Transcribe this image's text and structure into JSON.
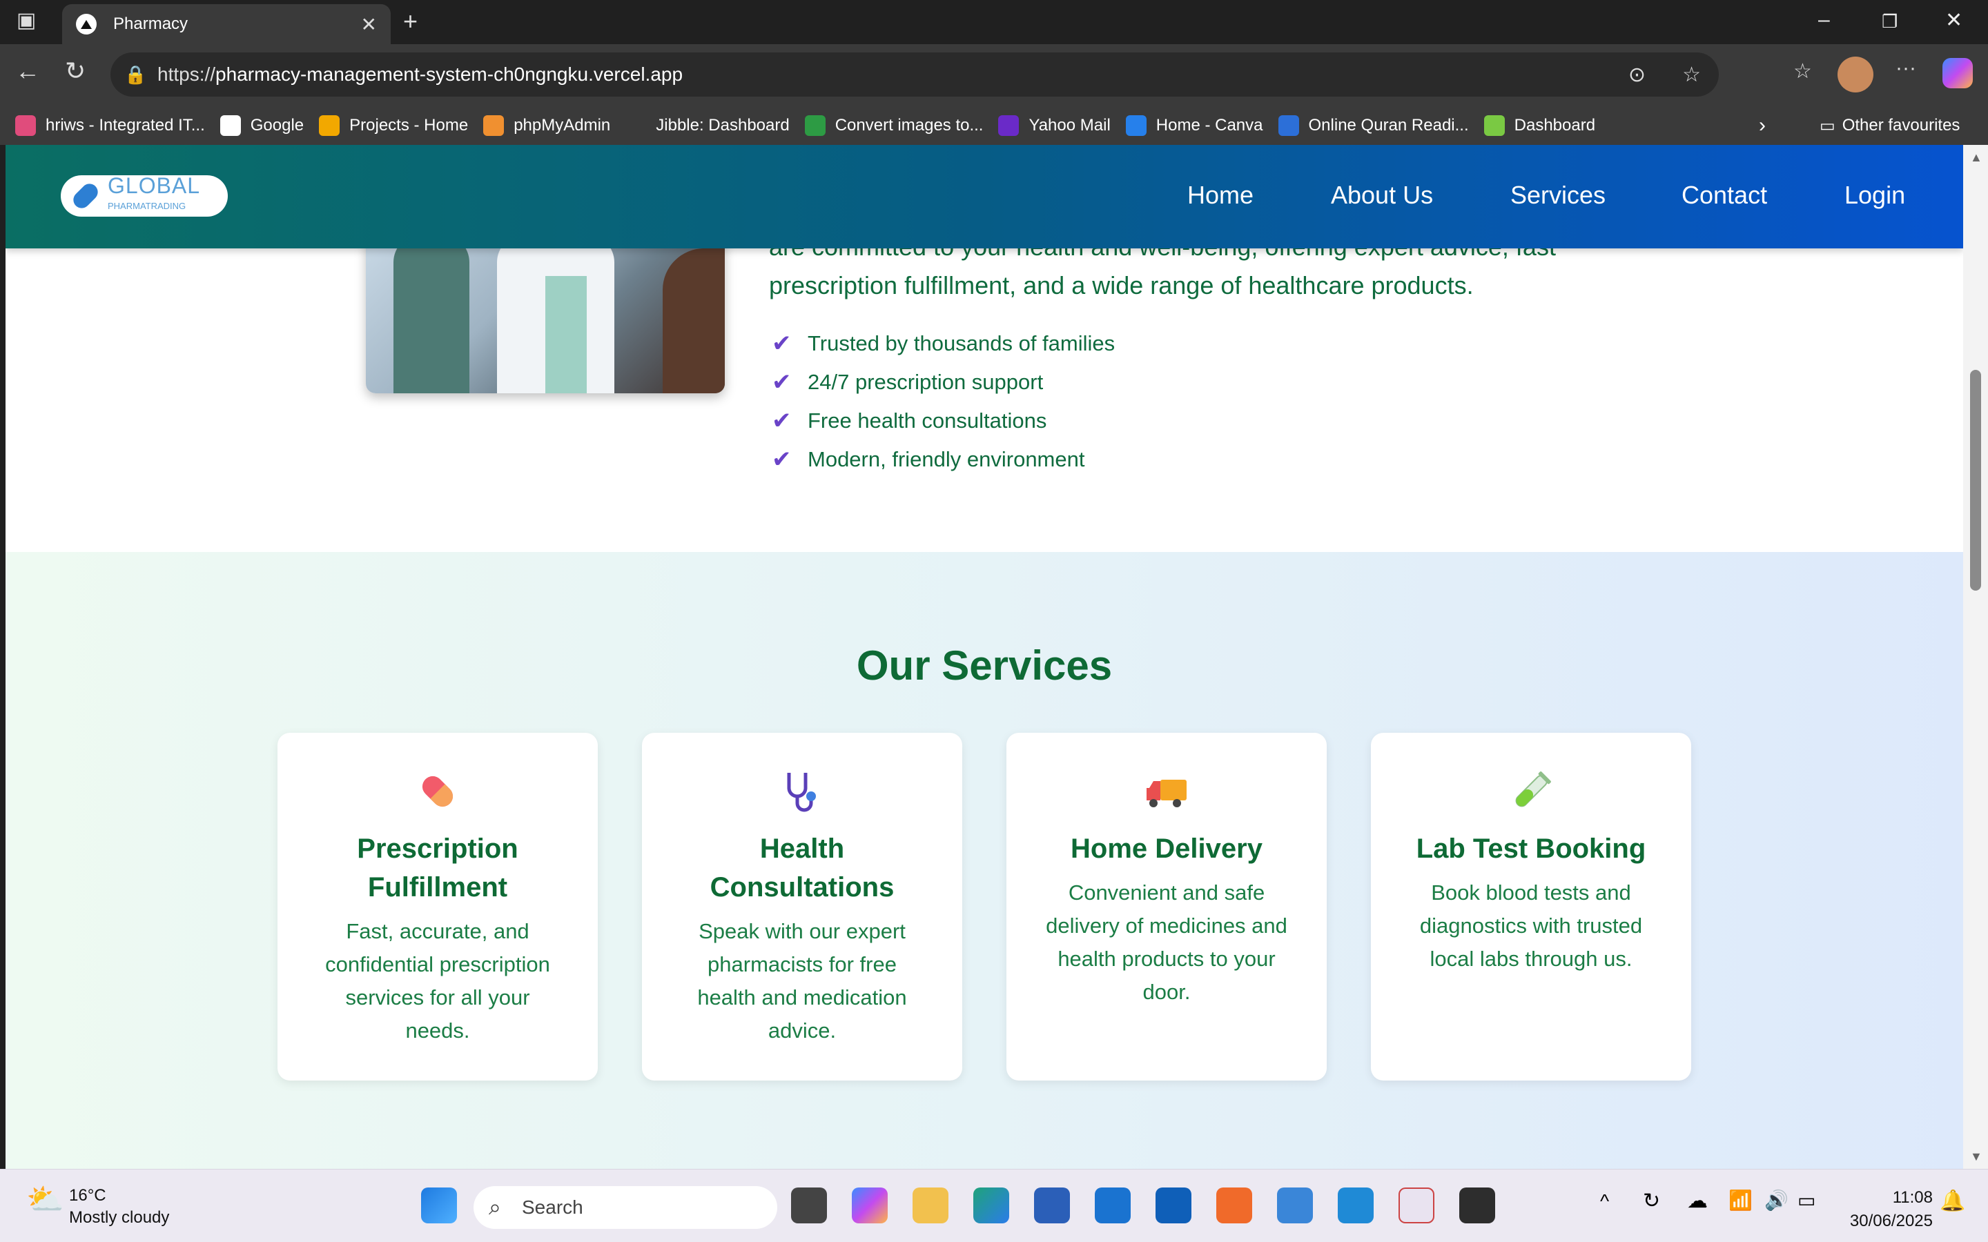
{
  "browser": {
    "tab_title": "Pharmacy",
    "url_prefix": "https://",
    "url_host": "pharmacy-management-system-ch0ngngku.vercel.app",
    "bookmarks": [
      {
        "label": "hriws - Integrated IT...",
        "color": "#e04c7c"
      },
      {
        "label": "Google",
        "color": "#ffffff"
      },
      {
        "label": "Projects - Home",
        "color": "#f2a800"
      },
      {
        "label": "phpMyAdmin",
        "color": "#f09030"
      },
      {
        "label": "Jibble: Dashboard",
        "color": "#3a3a3a"
      },
      {
        "label": "Convert images to...",
        "color": "#2d9b44"
      },
      {
        "label": "Yahoo Mail",
        "color": "#6a2ac8"
      },
      {
        "label": "Home - Canva",
        "color": "#2680eb"
      },
      {
        "label": "Online Quran Readi...",
        "color": "#2c6fd8"
      },
      {
        "label": "Dashboard",
        "color": "#7ac943"
      }
    ],
    "other_favourites": "Other favourites"
  },
  "nav": {
    "logo_text": "GLOBAL",
    "logo_subtext": "PHARMATRADING",
    "links": [
      "Home",
      "About Us",
      "Services",
      "Contact",
      "Login"
    ]
  },
  "about": {
    "paragraph_line1": "are committed to your health and well-being, offering expert advice, fast",
    "paragraph_line2": "prescription fulfillment, and a wide range of healthcare products.",
    "checklist": [
      "Trusted by thousands of families",
      "24/7 prescription support",
      "Free health consultations",
      "Modern, friendly environment"
    ]
  },
  "services": {
    "title": "Our Services",
    "cards": [
      {
        "icon": "pill-icon",
        "title": "Prescription Fulfillment",
        "text": "Fast, accurate, and confidential prescription services for all your needs."
      },
      {
        "icon": "stethoscope-icon",
        "title": "Health Consultations",
        "text": "Speak with our expert pharmacists for free health and medication advice."
      },
      {
        "icon": "delivery-truck-icon",
        "title": "Home Delivery",
        "text": "Convenient and safe delivery of medicines and health products to your door."
      },
      {
        "icon": "test-tube-icon",
        "title": "Lab Test Booking",
        "text": "Book blood tests and diagnostics with trusted local labs through us."
      }
    ]
  },
  "taskbar": {
    "weather_temp": "16°C",
    "weather_desc": "Mostly cloudy",
    "search_placeholder": "Search",
    "time": "11:08",
    "date": "30/06/2025"
  }
}
